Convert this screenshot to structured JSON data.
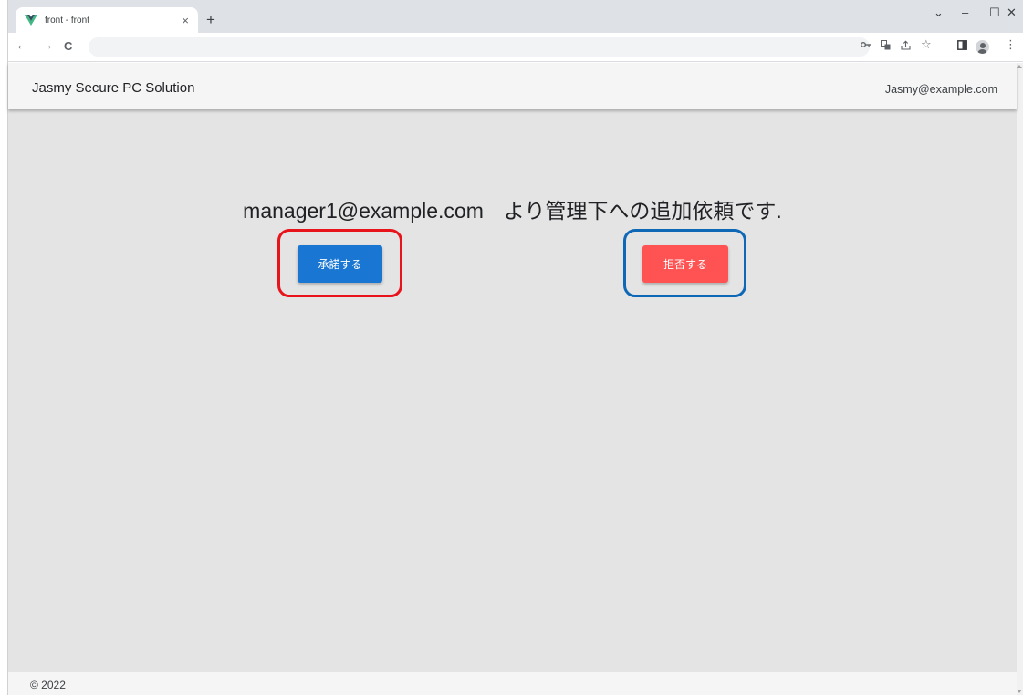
{
  "browser": {
    "tab_title": "front - front",
    "tab_close": "×",
    "new_tab": "+",
    "window_controls": {
      "chevron": "⌄",
      "minimize": "–",
      "maximize": "☐",
      "close": "✕"
    },
    "nav": {
      "back": "←",
      "forward": "→",
      "reload": "C"
    },
    "toolbar_icons": [
      "key-icon",
      "translate-icon",
      "share-icon",
      "star-icon",
      "side-panel-icon",
      "profile-icon",
      "menu-icon"
    ],
    "menu": "⋮"
  },
  "app": {
    "title": "Jasmy Secure PC Solution",
    "user_email": "Jasmy@example.com",
    "request": {
      "requester_email": "manager1@example.com",
      "message": "より管理下への追加依頼です."
    },
    "buttons": {
      "accept_label": "承諾する",
      "reject_label": "拒否する"
    },
    "footer": "© 2022"
  },
  "colors": {
    "accept": "#1976d2",
    "reject": "#ff5252",
    "highlight_accept": "#e8141c",
    "highlight_reject": "#0f68b6",
    "background": "#e4e4e4"
  }
}
